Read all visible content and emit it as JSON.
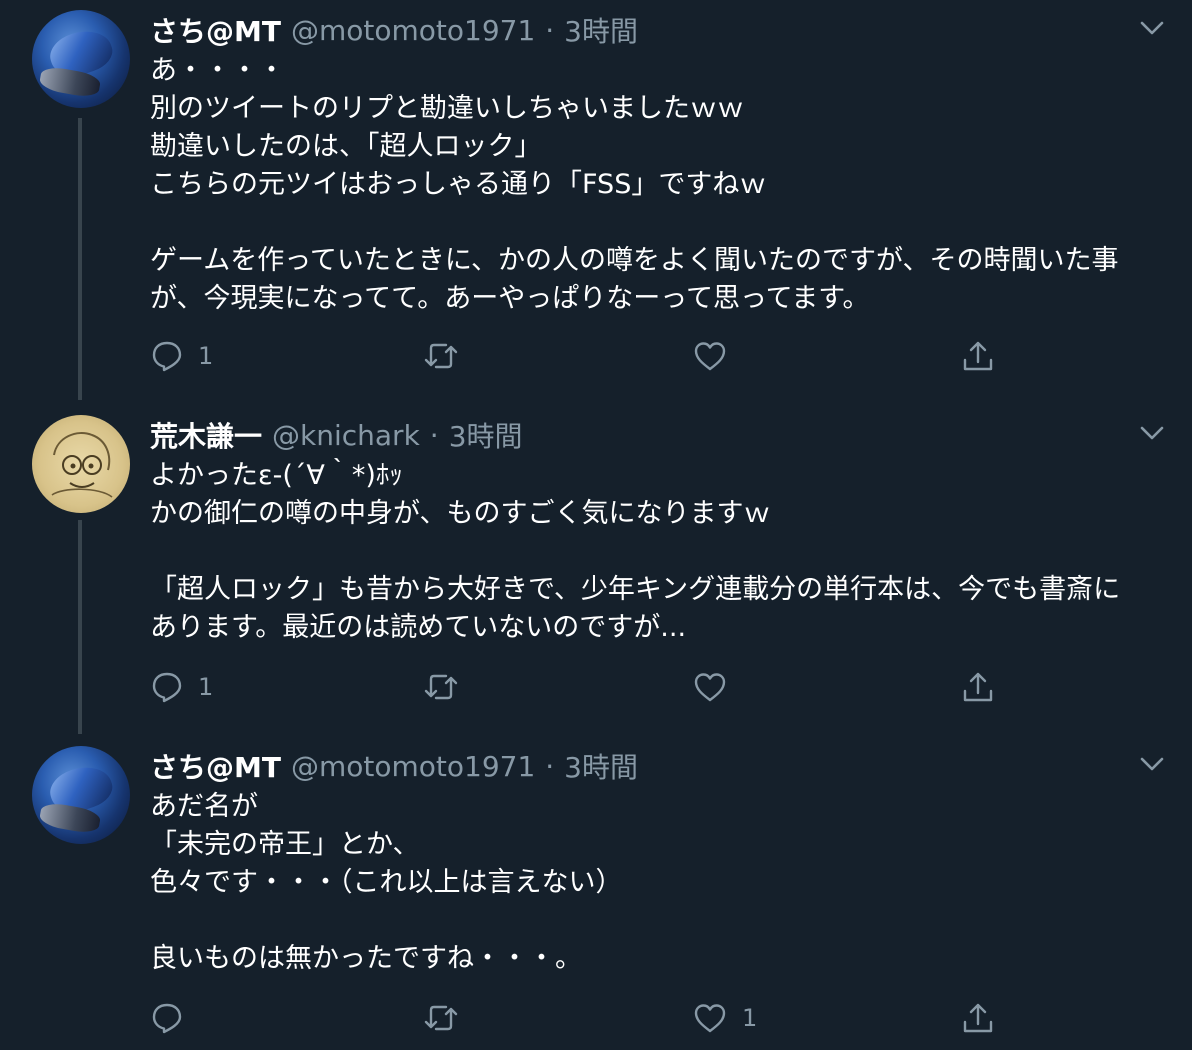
{
  "tweets": [
    {
      "display_name": "さち@MT",
      "handle": "@motomoto1971",
      "separator": "·",
      "time": "3時間",
      "avatar": "motorcycle-avatar",
      "lines": [
        "あ・・・・",
        "別のツイートのリプと勘違いしちゃいましたｗｗ",
        "勘違いしたのは、「超人ロック」",
        "こちらの元ツイはおっしゃる通り「FSS」ですねｗ",
        "",
        "ゲームを作っていたときに、かの人の噂をよく聞いたのですが、その時聞いた事",
        "が、今現実になってて。あーやっぱりなーって思ってます。"
      ],
      "reply_count": "1",
      "retweet_count": "",
      "like_count": ""
    },
    {
      "display_name": "荒木謙一",
      "handle": "@knichark",
      "separator": "·",
      "time": "3時間",
      "avatar": "illustration-avatar",
      "lines": [
        "よかったε-(´∀｀*)ﾎｯ",
        "かの御仁の噂の中身が、ものすごく気になりますｗ",
        "",
        "「超人ロック」も昔から大好きで、少年キング連載分の単行本は、今でも書斎に",
        "あります。最近のは読めていないのですが..."
      ],
      "reply_count": "1",
      "retweet_count": "",
      "like_count": ""
    },
    {
      "display_name": "さち@MT",
      "handle": "@motomoto1971",
      "separator": "·",
      "time": "3時間",
      "avatar": "motorcycle-avatar",
      "lines": [
        "あだ名が",
        "「未完の帝王」とか、",
        "色々です・・・（これ以上は言えない）",
        "",
        "良いものは無かったですね・・・。"
      ],
      "reply_count": "",
      "retweet_count": "",
      "like_count": "1"
    }
  ],
  "icons": {
    "reply": "reply-icon",
    "retweet": "retweet-icon",
    "like": "heart-icon",
    "share": "share-icon",
    "more": "chevron-down-icon"
  },
  "colors": {
    "background": "#15202b",
    "secondary_text": "#8899a6",
    "thread_line": "#38444d"
  }
}
